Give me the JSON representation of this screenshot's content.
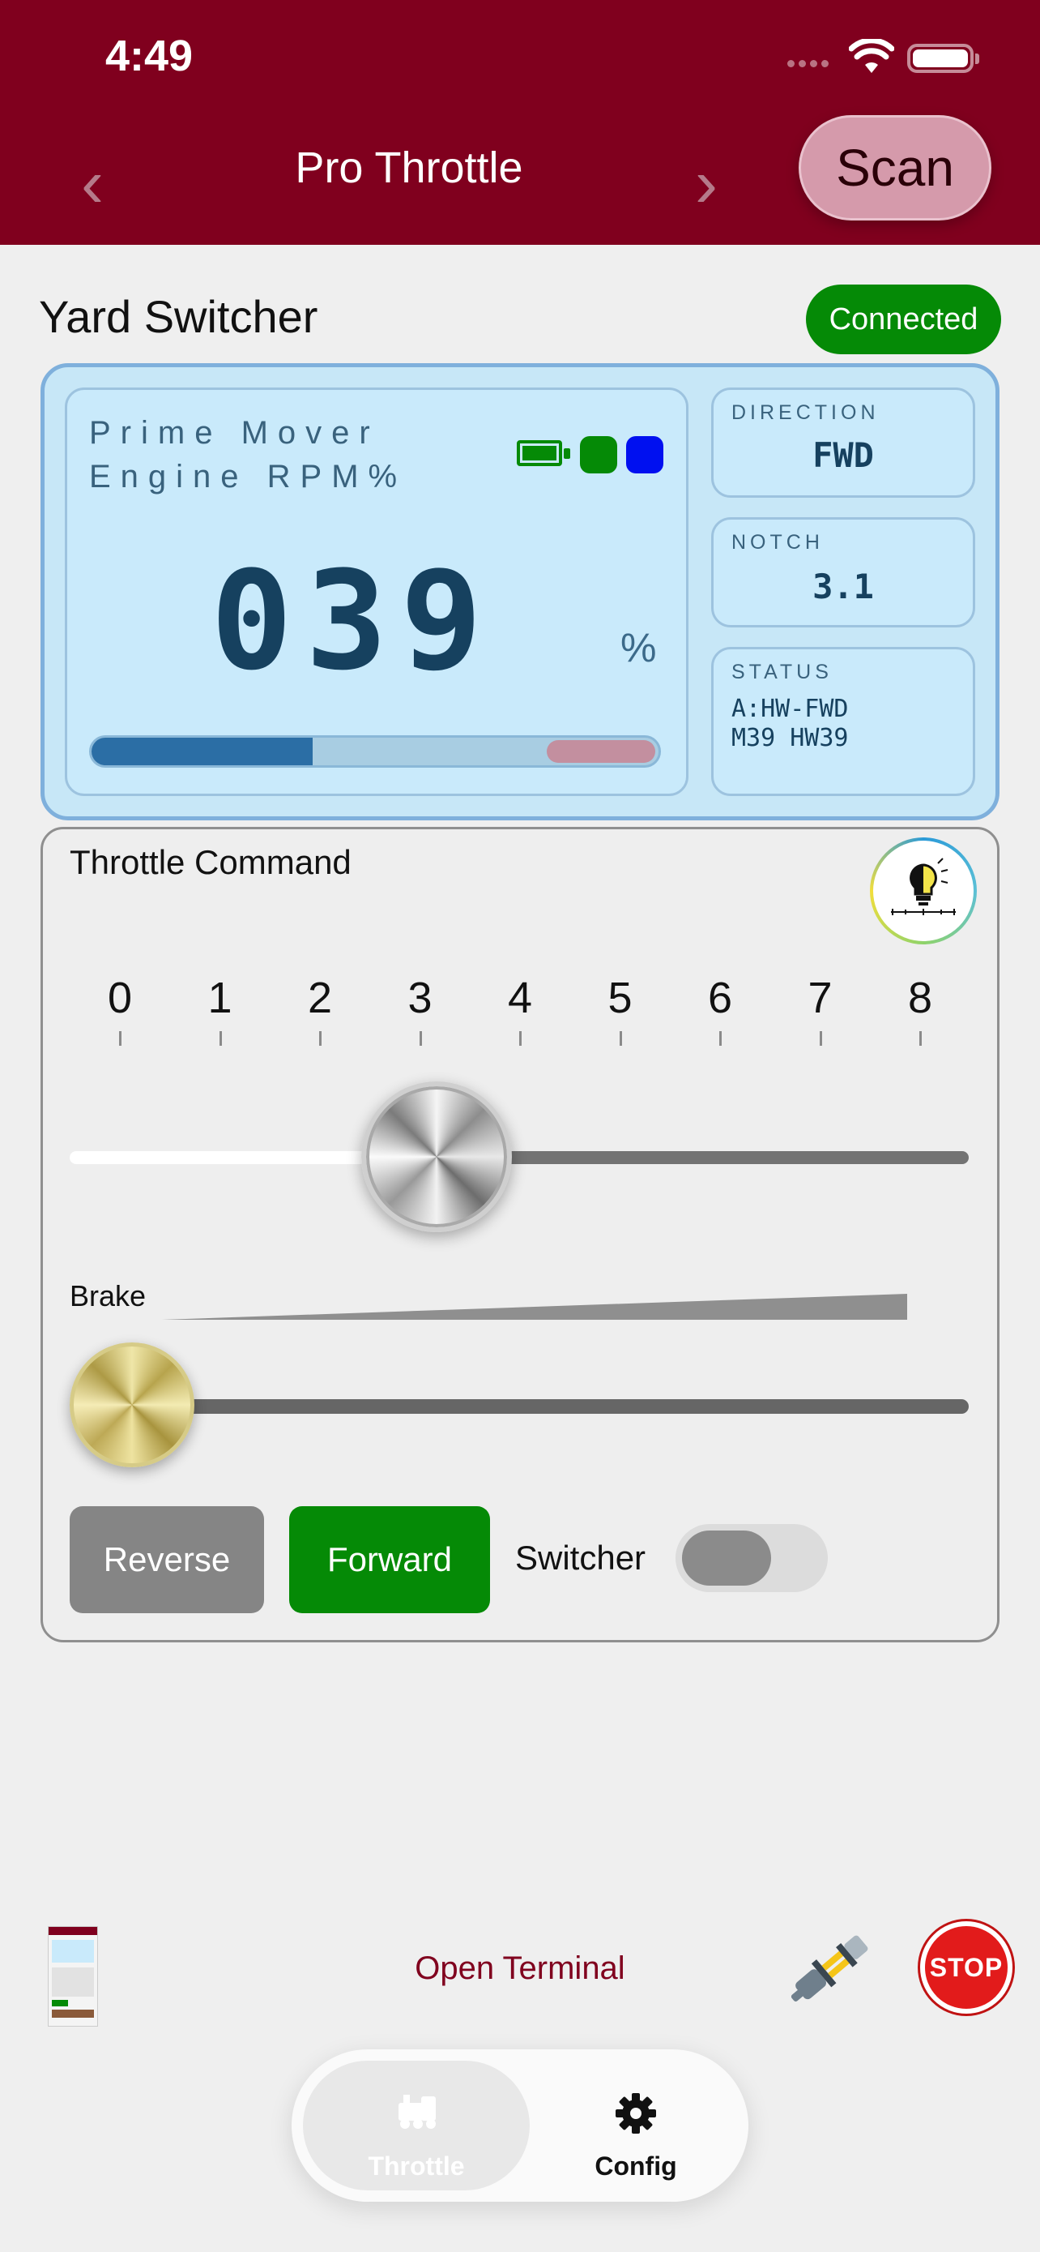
{
  "status_bar": {
    "time": "4:49"
  },
  "nav": {
    "back": "‹",
    "title": "Pro Throttle",
    "forward": "›",
    "scan_label": "Scan"
  },
  "loco": {
    "name": "Yard Switcher",
    "connection": "Connected"
  },
  "display": {
    "rpm_label_line1": "Prime Mover",
    "rpm_label_line2": "Engine RPM%",
    "rpm_value": "039",
    "rpm_unit": "%",
    "rpm_fraction": 0.39,
    "direction_label": "DIRECTION",
    "direction_value": "FWD",
    "notch_label": "NOTCH",
    "notch_value": "3.1",
    "status_label": "STATUS",
    "status_line1": "A:HW-FWD",
    "status_line2": "M39 HW39"
  },
  "throttle": {
    "title": "Throttle Command",
    "ticks": [
      "0",
      "1",
      "2",
      "3",
      "4",
      "5",
      "6",
      "7",
      "8"
    ],
    "value": 3.1,
    "brake_label": "Brake",
    "brake_value": 0,
    "reverse_label": "Reverse",
    "forward_label": "Forward",
    "switcher_label": "Switcher",
    "switcher_on": false
  },
  "bottom": {
    "terminal_link": "Open Terminal",
    "stop_label": "STOP"
  },
  "tabs": [
    {
      "label": "Throttle",
      "icon": "train-icon",
      "active": true
    },
    {
      "label": "Config",
      "icon": "gear-icon",
      "active": false
    }
  ],
  "colors": {
    "header": "#80001e",
    "connected": "#058a06",
    "forward": "#058a06",
    "display_bg": "#c9eafb"
  }
}
